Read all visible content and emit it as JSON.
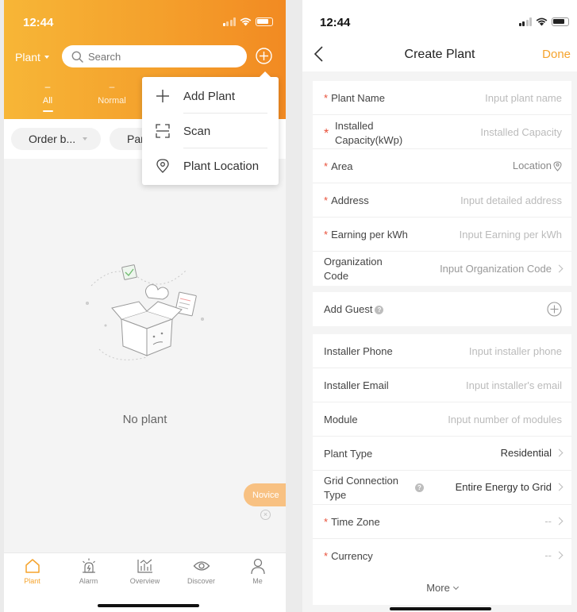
{
  "left": {
    "status_time": "12:44",
    "plant_selector": "Plant",
    "search_placeholder": "Search",
    "tabs": [
      {
        "label": "All",
        "count": "–"
      },
      {
        "label": "Normal",
        "count": "–"
      }
    ],
    "filters": [
      {
        "label": "Order b..."
      },
      {
        "label": "Para"
      }
    ],
    "dropdown": [
      {
        "label": "Add Plant",
        "icon": "plus-icon"
      },
      {
        "label": "Scan",
        "icon": "scan-icon"
      },
      {
        "label": "Plant Location",
        "icon": "location-pin-icon"
      }
    ],
    "empty_text": "No plant",
    "novice_label": "Novice",
    "novice_close": "×",
    "nav": [
      {
        "label": "Plant",
        "icon": "home-icon"
      },
      {
        "label": "Alarm",
        "icon": "alarm-icon"
      },
      {
        "label": "Overview",
        "icon": "chart-icon"
      },
      {
        "label": "Discover",
        "icon": "eye-icon"
      },
      {
        "label": "Me",
        "icon": "person-icon"
      }
    ],
    "accent_color": "#f5a32c"
  },
  "right": {
    "status_time": "12:44",
    "title": "Create Plant",
    "done_label": "Done",
    "section1": [
      {
        "label": "Plant Name",
        "required": true,
        "value": "Input plant name"
      },
      {
        "label": "Installed Capacity(kWp)",
        "required": true,
        "value": "Installed Capacity"
      },
      {
        "label": "Area",
        "required": true,
        "value": "Location"
      },
      {
        "label": "Address",
        "required": true,
        "value": "Input detailed address"
      },
      {
        "label": "Earning per kWh",
        "required": true,
        "value": "Input Earning per kWh"
      },
      {
        "label": "Organization Code",
        "required": false,
        "value": "Input Organization Code"
      }
    ],
    "guest": {
      "label": "Add Guest",
      "help": "?"
    },
    "section3": [
      {
        "label": "Installer Phone",
        "value": "Input installer phone"
      },
      {
        "label": "Installer Email",
        "value": "Input installer's email"
      },
      {
        "label": "Module",
        "value": "Input number of modules"
      },
      {
        "label": "Plant Type",
        "value": "Residential"
      },
      {
        "label": "Grid Connection Type",
        "value": "Entire Energy to Grid",
        "help": "?"
      },
      {
        "label": "Time Zone",
        "value": "--",
        "required": true
      },
      {
        "label": "Currency",
        "value": "--",
        "required": true
      }
    ],
    "more_label": "More"
  }
}
